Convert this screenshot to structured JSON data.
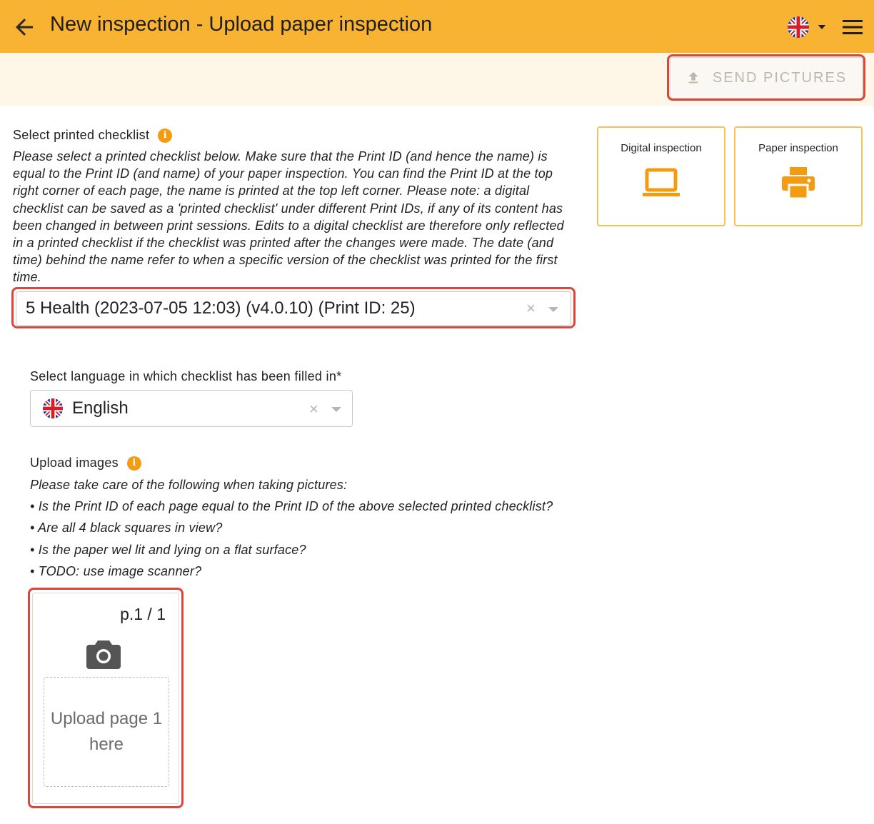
{
  "appbar": {
    "title": "New inspection - Upload paper inspection",
    "back_icon": "arrow-left-icon",
    "language_icon": "uk-flag-icon",
    "menu_icon": "hamburger-menu-icon"
  },
  "toolbar": {
    "send_label": "SEND PICTURES",
    "send_icon": "upload-icon"
  },
  "checklist": {
    "label": "Select printed checklist",
    "help": "Please select a printed checklist below. Make sure that the Print ID (and hence the name) is equal to the Print ID (and name) of your paper inspection. You can find the Print ID at the top right corner of each page, the name is printed at the top left corner. Please note: a digital checklist can be saved as a 'printed checklist' under different Print IDs, if any of its content has been changed in between print sessions. Edits to a digital checklist are therefore only reflected in a printed checklist if the checklist was printed after the changes were made. The date (and time) behind the name refer to when a specific version of the checklist was printed for the first time.",
    "selected": "5 Health (2023-07-05 12:03) (v4.0.10) (Print ID: 25)"
  },
  "modes": {
    "digital_label": "Digital inspection",
    "paper_label": "Paper inspection"
  },
  "language": {
    "label": "Select language in which checklist has been filled in*",
    "selected": "English"
  },
  "upload": {
    "label": "Upload images",
    "intro": "Please take care of the following when taking pictures:",
    "tips": [
      "• Is the Print ID of each page equal to the Print ID of the above selected printed checklist?",
      "• Are all 4 black squares in view?",
      "• Is the paper wel lit and lying on a flat surface?",
      "• TODO: use image scanner?"
    ],
    "page_indicator": "p.1 / 1",
    "drop_text": "Upload page 1 here"
  },
  "colors": {
    "appbar": "#f8b333",
    "toolbar": "#fef6e7",
    "accent": "#f39c12",
    "highlight": "#d9473b"
  }
}
